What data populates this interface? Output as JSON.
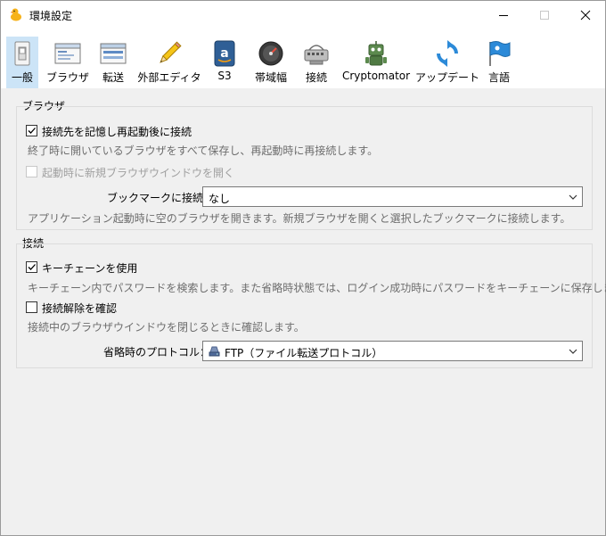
{
  "window": {
    "title": "環境設定"
  },
  "toolbar": {
    "items": [
      {
        "label": "一般"
      },
      {
        "label": "ブラウザ"
      },
      {
        "label": "転送"
      },
      {
        "label": "外部エディタ"
      },
      {
        "label": "S3"
      },
      {
        "label": "帯域幅"
      },
      {
        "label": "接続"
      },
      {
        "label": "Cryptomator"
      },
      {
        "label": "アップデート"
      },
      {
        "label": "言語"
      }
    ],
    "selected": "一般"
  },
  "browser_section": {
    "title": "ブラウザ",
    "save_workspace": {
      "label": "接続先を記憶し再起動後に接続",
      "checked": true
    },
    "save_workspace_desc": "終了時に開いているブラウザをすべて保存し、再起動時に再接続します。",
    "open_new_window": {
      "label": "起動時に新規ブラウザウインドウを開く",
      "checked": false,
      "disabled": true
    },
    "bookmark_label": "ブックマークに接続：",
    "bookmark_value": "なし",
    "bookmark_desc": "アプリケーション起動時に空のブラウザを開きます。新規ブラウザを開くと選択したブックマークに接続します。"
  },
  "connection_section": {
    "title": "接続",
    "keychain": {
      "label": "キーチェーンを使用",
      "checked": true
    },
    "keychain_desc": "キーチェーン内でパスワードを検索します。また省略時状態では、ログイン成功時にパスワードをキーチェーンに保存します。",
    "confirm_disconnect": {
      "label": "接続解除を確認",
      "checked": false
    },
    "confirm_disconnect_desc": "接続中のブラウザウインドウを閉じるときに確認します。",
    "protocol_label": "省略時のプロトコル：",
    "protocol_value": "FTP（ファイル転送プロトコル）"
  },
  "colors": {
    "selected_tab": "#cce4f7",
    "window_bg": "#f0f0f0",
    "description_text": "#6d6d6d"
  }
}
